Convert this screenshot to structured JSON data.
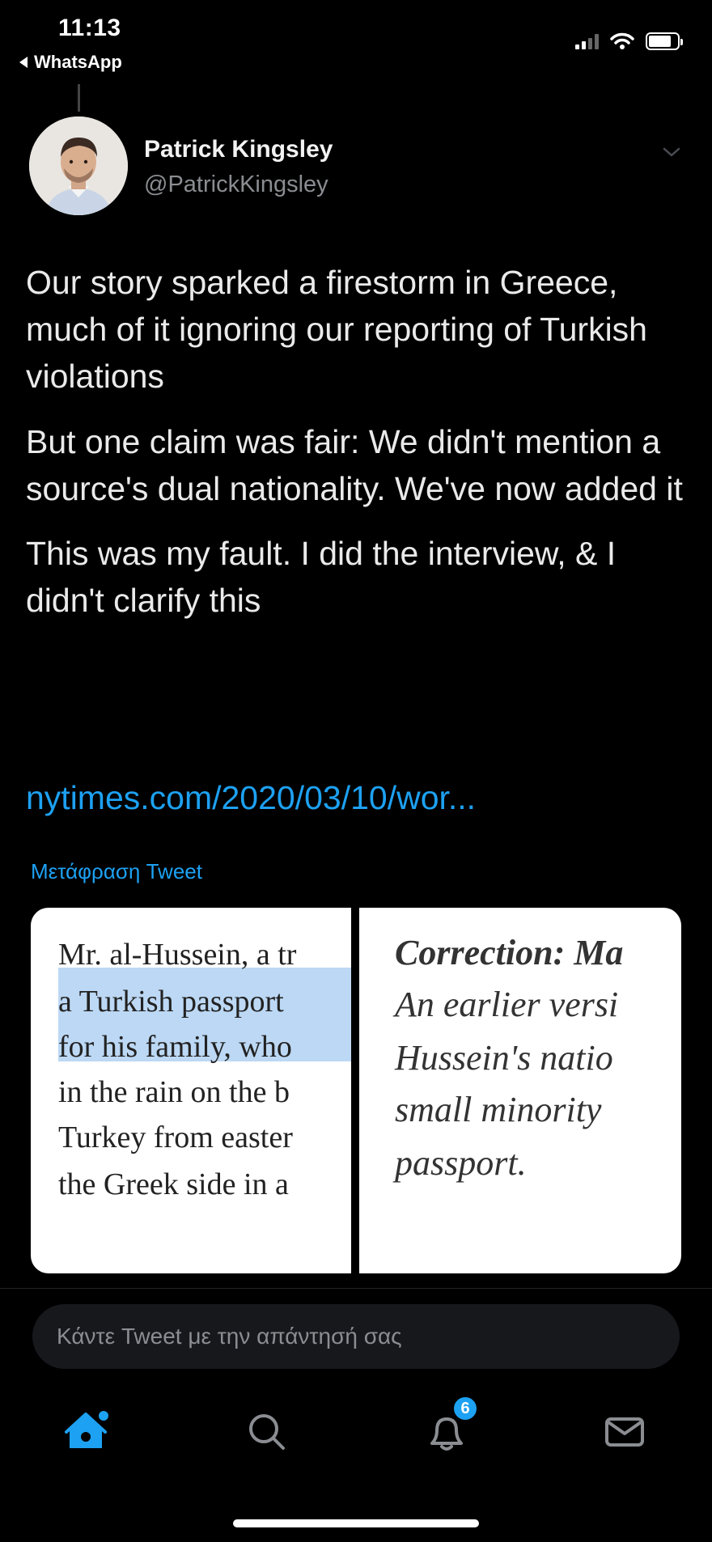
{
  "status_bar": {
    "time": "11:13",
    "back_app": "WhatsApp"
  },
  "tweet": {
    "author_name": "Patrick Kingsley",
    "author_handle": "@PatrickKingsley",
    "paragraphs": [
      "Our story sparked a firestorm in Greece, much of it ignoring our reporting of Turkish violations",
      "But one claim was fair: We didn't mention a source's dual nationality. We've now added it",
      "This was my fault. I did the interview, & I didn't clarify this"
    ],
    "link": "nytimes.com/2020/03/10/wor...",
    "translate_label": "Μετάφραση Tweet",
    "media": {
      "left_lines": [
        "Mr. al-Hussein, a tr",
        "a Turkish passport",
        "for his family, who",
        "in the rain on the b",
        "Turkey from easter",
        "the Greek side in a"
      ],
      "right_lines": [
        "Correction: Ma",
        "An earlier versi",
        "Hussein's natio",
        "small minority",
        "passport."
      ]
    }
  },
  "reply": {
    "placeholder": "Κάντε Tweet με την απάντησή σας"
  },
  "tabbar": {
    "notifications_badge": "6",
    "accent_color": "#1da1f2"
  }
}
